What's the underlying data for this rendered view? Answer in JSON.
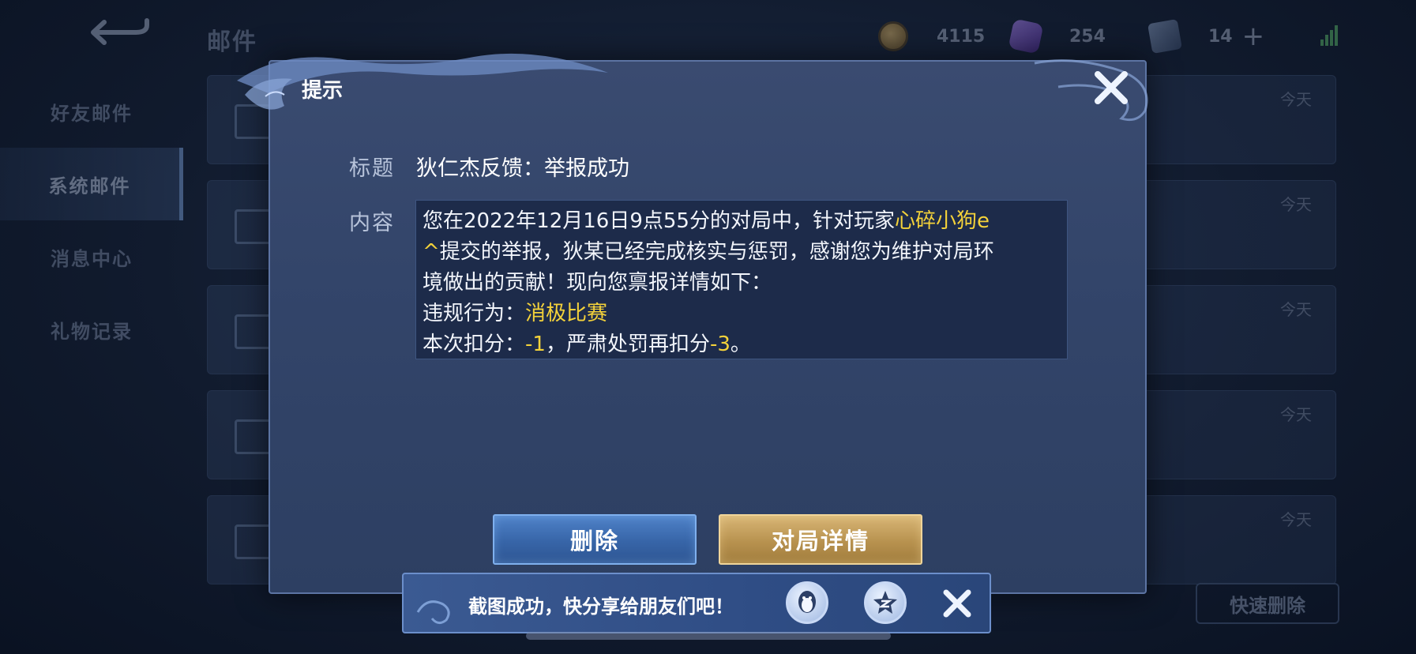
{
  "header": {
    "title": "邮件",
    "currencies": [
      {
        "icon": "gold-coin-icon",
        "value": "4115"
      },
      {
        "icon": "diamond-gem-icon",
        "value": "254"
      },
      {
        "icon": "coupon-icon",
        "value": "14"
      }
    ]
  },
  "sidebar": {
    "items": [
      {
        "label": "好友邮件"
      },
      {
        "label": "系统邮件",
        "active": true
      },
      {
        "label": "消息中心"
      },
      {
        "label": "礼物记录"
      }
    ]
  },
  "mail_list": {
    "rows": [
      {
        "date": "今天"
      },
      {
        "date": "今天"
      },
      {
        "date": "今天"
      },
      {
        "date": "今天"
      },
      {
        "date": "今天"
      }
    ],
    "quick_delete_label": "快速删除"
  },
  "dialog": {
    "title": "提示",
    "subject_label": "标题",
    "subject": "狄仁杰反馈：举报成功",
    "content_label": "内容",
    "content": {
      "line1_a": "您在2022年12月16日9点55分的对局中，针对玩家",
      "player": "心碎小狗e",
      "line2_a": "^",
      "line2_b": "提交的举报，狄某已经完成核实与惩罚，感谢您为维护对局环",
      "line3": "境做出的贡献！现向您禀报详情如下：",
      "violation_label": "违规行为：",
      "violation": "消极比赛",
      "penalty_label": "本次扣分：",
      "penalty_score": "-1",
      "penalty_mid": "，严肃处罚再扣分",
      "penalty_extra": "-3",
      "penalty_end": "。"
    },
    "delete_label": "删除",
    "detail_label": "对局详情"
  },
  "toast": {
    "text": "截图成功，快分享给朋友们吧！"
  },
  "colors": {
    "highlight": "#f4d23a",
    "dialog_bg": "#33456a",
    "delete_btn": "#3765a8",
    "detail_btn": "#b8924f"
  }
}
